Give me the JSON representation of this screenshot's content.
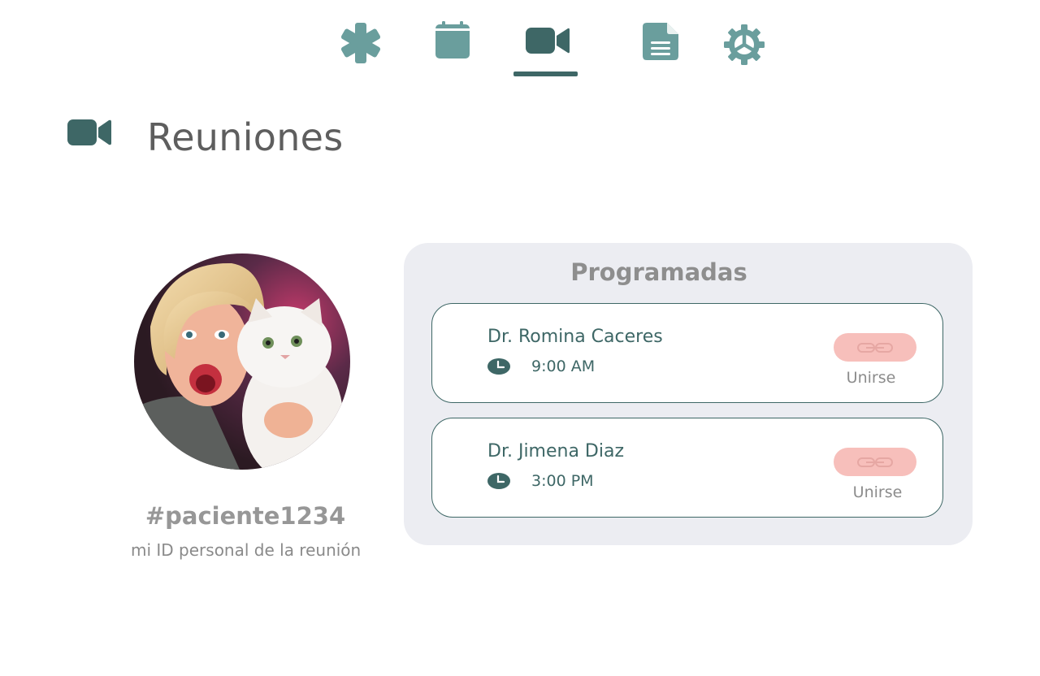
{
  "nav": {
    "items": [
      {
        "icon": "asterisk-icon",
        "label": "Inicio"
      },
      {
        "icon": "calendar-icon",
        "label": "Calendario"
      },
      {
        "icon": "video-camera-icon",
        "label": "Reuniones",
        "active": true
      },
      {
        "icon": "document-icon",
        "label": "Documentos"
      },
      {
        "icon": "gear-icon",
        "label": "Configuración"
      }
    ]
  },
  "header": {
    "title": "Reuniones",
    "icon": "video-camera-icon"
  },
  "profile": {
    "meeting_id": "#paciente1234",
    "caption": "mi ID personal de la reunión"
  },
  "scheduled": {
    "title": "Programadas",
    "meetings": [
      {
        "doctor": "Dr. Romina Caceres",
        "time": "9:00 AM",
        "join_label": "Unirse"
      },
      {
        "doctor": "Dr. Jimena Diaz",
        "time": "3:00 PM",
        "join_label": "Unirse"
      }
    ]
  },
  "colors": {
    "primary_dark": "#3e6766",
    "primary_light": "#6a9e9d",
    "panel_bg": "#ecedf2",
    "join_button": "#f7bfbb"
  }
}
